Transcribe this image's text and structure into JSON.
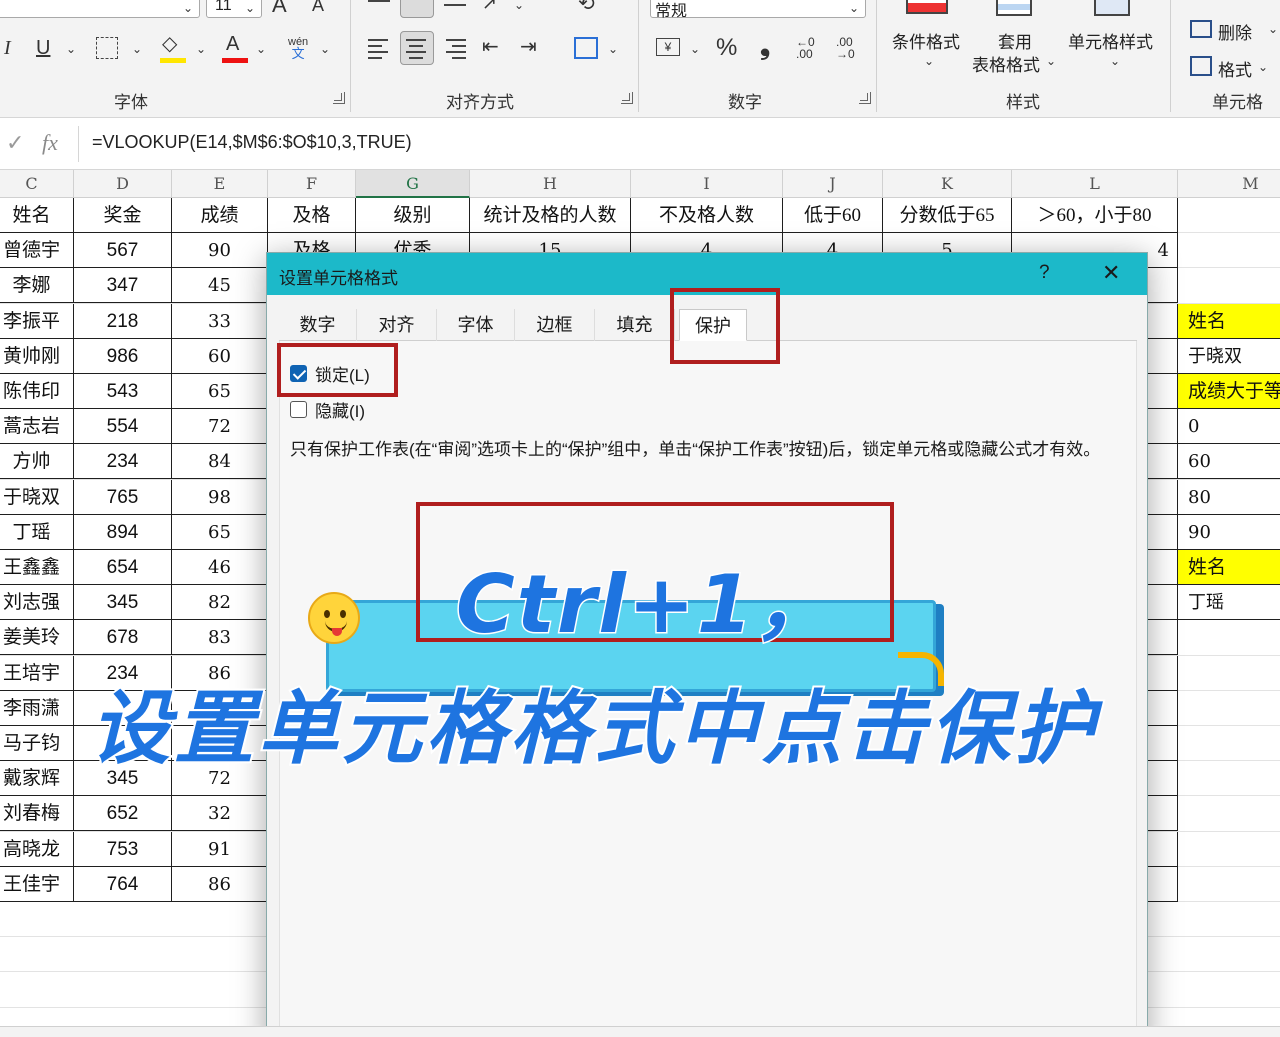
{
  "ribbon": {
    "groups": {
      "font": "字体",
      "align": "对齐方式",
      "number": "数字",
      "styles": "样式",
      "cells": "单元格"
    },
    "font": {
      "size": "11",
      "wen": "wén",
      "wen_char": "文"
    },
    "number": {
      "format": "常规",
      "percent": "%",
      "comma": "❟"
    },
    "styles": {
      "conditional": "条件格式",
      "table_line1": "套用",
      "table_line2": "表格格式",
      "cell_style": "单元格样式"
    },
    "cells": {
      "delete": "删除",
      "format": "格式"
    }
  },
  "formula_bar": {
    "formula": "=VLOOKUP(E14,$M$6:$O$10,3,TRUE)"
  },
  "columns": [
    "C",
    "D",
    "E",
    "F",
    "G",
    "H",
    "I",
    "J",
    "K",
    "L",
    "M"
  ],
  "table_header": [
    "姓名",
    "奖金",
    "成绩",
    "及格",
    "级别",
    "统计及格的人数",
    "不及格人数",
    "低于60",
    "分数低于65",
    "＞60，小于80"
  ],
  "row1_extra": {
    "F": "及格",
    "G": "优秀",
    "H": "15",
    "I": "4",
    "J": "4",
    "K": "5",
    "L": "4"
  },
  "rows": [
    {
      "name": "曾德宇",
      "bonus": "567",
      "score": "90"
    },
    {
      "name": "李娜",
      "bonus": "347",
      "score": "45"
    },
    {
      "name": "李振平",
      "bonus": "218",
      "score": "33"
    },
    {
      "name": "黄帅刚",
      "bonus": "986",
      "score": "60"
    },
    {
      "name": "陈伟印",
      "bonus": "543",
      "score": "65"
    },
    {
      "name": "蒿志岩",
      "bonus": "554",
      "score": "72"
    },
    {
      "name": "方帅",
      "bonus": "234",
      "score": "84"
    },
    {
      "name": "于晓双",
      "bonus": "765",
      "score": "98"
    },
    {
      "name": "丁瑶",
      "bonus": "894",
      "score": "65"
    },
    {
      "name": "王鑫鑫",
      "bonus": "654",
      "score": "46"
    },
    {
      "name": "刘志强",
      "bonus": "345",
      "score": "82"
    },
    {
      "name": "姜美玲",
      "bonus": "678",
      "score": "83"
    },
    {
      "name": "王培宇",
      "bonus": "234",
      "score": "86"
    },
    {
      "name": "李雨潇",
      "bonus": "",
      "score": ""
    },
    {
      "name": "马子钧",
      "bonus": "",
      "score": "91"
    },
    {
      "name": "戴家辉",
      "bonus": "345",
      "score": "72"
    },
    {
      "name": "刘春梅",
      "bonus": "652",
      "score": "32"
    },
    {
      "name": "高晓龙",
      "bonus": "753",
      "score": "91"
    },
    {
      "name": "王佳宇",
      "bonus": "764",
      "score": "86"
    }
  ],
  "col_m": [
    "姓名",
    "于晓双",
    "成绩大于等",
    "0",
    "60",
    "80",
    "90",
    "姓名",
    "丁瑶"
  ],
  "dialog": {
    "title": "设置单元格格式",
    "help": "?",
    "close": "✕",
    "tabs": [
      "数字",
      "对齐",
      "字体",
      "边框",
      "填充",
      "保护"
    ],
    "locked_label": "锁定(L)",
    "hidden_label": "隐藏(I)",
    "note": "只有保护工作表(在“审阅”选项卡上的“保护”组中，单击“保护工作表”按钮)后，锁定单元格或隐藏公式才有效。"
  },
  "caption": {
    "line1": "Ctrl+1，",
    "line2": "设置单元格格式中点击保护"
  },
  "colors": {
    "dialog_title": "#1cb9c9",
    "annotation_red": "#b01e1e",
    "caption_blue": "#1e74e0",
    "banner": "#5bd4f0",
    "highlight_yellow": "#ffff00",
    "checkbox_blue": "#0f63b3"
  }
}
